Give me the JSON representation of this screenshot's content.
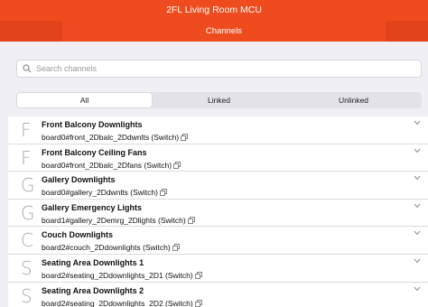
{
  "header": {
    "title": "2FL Living Room MCU",
    "tab_label": "Channels"
  },
  "search": {
    "placeholder": "Search channels",
    "icon": "search-icon"
  },
  "filter": {
    "options": [
      "All",
      "Linked",
      "Unlinked"
    ],
    "selected": "All"
  },
  "channels": [
    {
      "letter": "F",
      "name": "Front Balcony Downlights",
      "id": "board0#front_2Dbalc_2Ddwnlts (Switch)"
    },
    {
      "letter": "F",
      "name": "Front Balcony Ceiling Fans",
      "id": "board0#front_2Dbalc_2Dfans (Switch)"
    },
    {
      "letter": "G",
      "name": "Gallery Downlights",
      "id": "board0#gallery_2Ddwnlts (Switch)"
    },
    {
      "letter": "G",
      "name": "Gallery Emergency Lights",
      "id": "board1#gallery_2Demrg_2Dlights (Switch)"
    },
    {
      "letter": "C",
      "name": "Couch Downlights",
      "id": "board2#couch_2Ddownlights (Switch)"
    },
    {
      "letter": "S",
      "name": "Seating Area Downlights 1",
      "id": "board2#seating_2Ddownlights_2D1 (Switch)"
    },
    {
      "letter": "S",
      "name": "Seating Area Downlights 2",
      "id": "board2#seating_2Ddownlights_2D2 (Switch)"
    }
  ],
  "colors": {
    "accent": "#ee4c1f",
    "accent_dark": "#e2431a",
    "background": "#efeff4"
  }
}
